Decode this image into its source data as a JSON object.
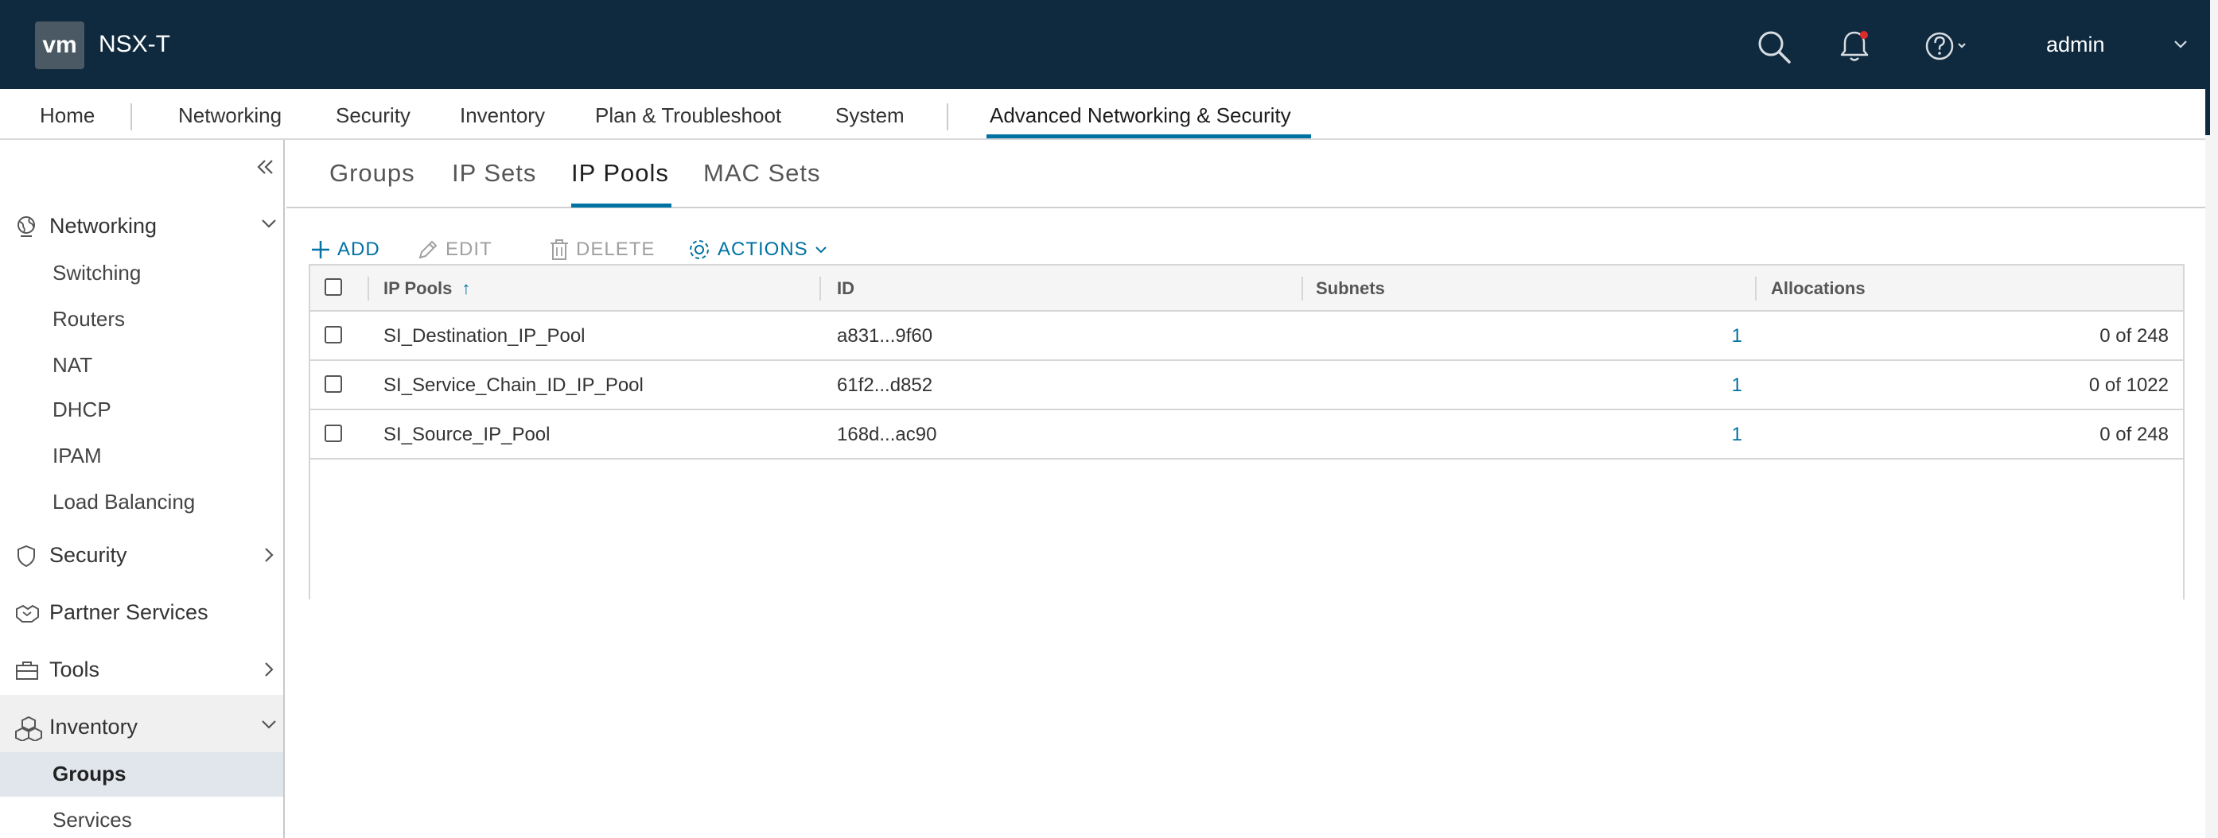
{
  "header": {
    "logo_text": "vm",
    "product": "NSX-T",
    "user": "admin",
    "icons": [
      "search-icon",
      "bell-icon",
      "help-icon"
    ],
    "notification_dot_color": "#e02b2b"
  },
  "topnav": {
    "items": [
      "Home",
      "Networking",
      "Security",
      "Inventory",
      "Plan & Troubleshoot",
      "System",
      "Advanced Networking & Security"
    ],
    "active": "Advanced Networking & Security"
  },
  "sidebar": {
    "sections": [
      {
        "label": "Networking",
        "icon": "globe-icon",
        "expanded": true
      },
      {
        "label": "Security",
        "icon": "shield-icon",
        "expanded": false
      },
      {
        "label": "Partner Services",
        "icon": "partner-icon"
      },
      {
        "label": "Tools",
        "icon": "toolbox-icon",
        "expanded": false
      },
      {
        "label": "Inventory",
        "icon": "boxes-icon",
        "expanded": true
      }
    ],
    "networking_items": [
      "Switching",
      "Routers",
      "NAT",
      "DHCP",
      "IPAM",
      "Load Balancing"
    ],
    "inventory_items": [
      "Groups",
      "Services"
    ],
    "active_item": "Groups"
  },
  "subtabs": {
    "items": [
      "Groups",
      "IP Sets",
      "IP Pools",
      "MAC Sets"
    ],
    "active": "IP Pools"
  },
  "toolbar": {
    "add": "ADD",
    "edit": "EDIT",
    "delete": "DELETE",
    "actions": "ACTIONS"
  },
  "table": {
    "columns": [
      "IP Pools",
      "ID",
      "Subnets",
      "Allocations"
    ],
    "sort_column": "IP Pools",
    "sort_direction": "ascending",
    "rows": [
      {
        "name": "SI_Destination_IP_Pool",
        "id": "a831...9f60",
        "subnets": "1",
        "allocations": "0 of 248"
      },
      {
        "name": "SI_Service_Chain_ID_IP_Pool",
        "id": "61f2...d852",
        "subnets": "1",
        "allocations": "0 of 1022"
      },
      {
        "name": "SI_Source_IP_Pool",
        "id": "168d...ac90",
        "subnets": "1",
        "allocations": "0 of 248"
      }
    ]
  },
  "colors": {
    "header_bg": "#0f2a3f",
    "accent": "#0072a3",
    "active_sidebar_bg": "#e0e6ec"
  }
}
